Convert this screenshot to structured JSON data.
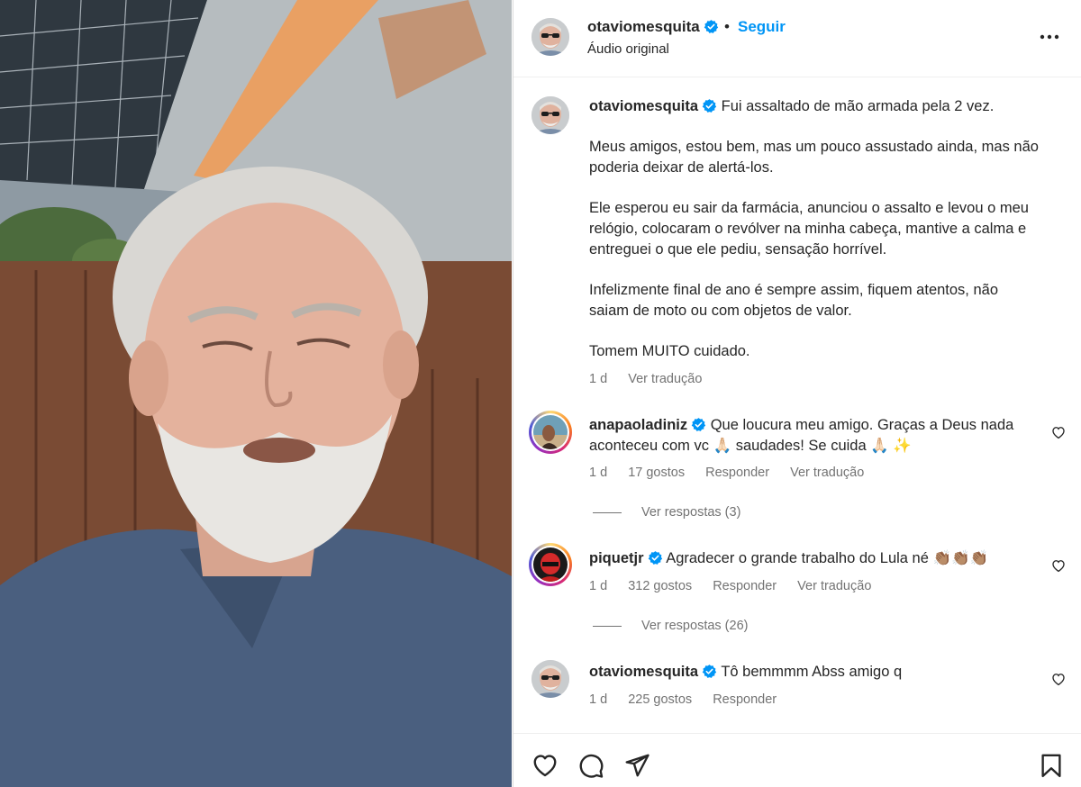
{
  "post": {
    "username": "otaviomesquita",
    "follow_label": "Seguir",
    "audio_label": "Áudio original"
  },
  "caption": {
    "username": "otaviomesquita",
    "paragraphs": [
      "Fui assaltado de mão armada pela 2 vez.",
      "Meus amigos, estou bem, mas um pouco assustado ainda, mas não poderia deixar de alertá-los.",
      "Ele esperou eu sair da farmácia, anunciou o assalto e levou o meu relógio, colocaram o revólver na minha cabeça, mantive a calma e entreguei o que ele pediu, sensação horrível.",
      "Infelizmente final de ano é sempre assim, fiquem atentos, não saiam de moto ou com objetos de valor.",
      "Tomem MUITO cuidado."
    ],
    "age": "1 d",
    "translate_label": "Ver tradução"
  },
  "comments": [
    {
      "username": "anapaoladiniz",
      "text": "Que loucura meu amigo. Graças a Deus nada aconteceu com vc 🙏🏻 saudades! Se cuida 🙏🏻 ✨",
      "age": "1 d",
      "likes": "17 gostos",
      "reply_label": "Responder",
      "translate_label": "Ver tradução",
      "view_replies": "Ver respostas (3)"
    },
    {
      "username": "piquetjr",
      "text": "Agradecer o grande trabalho do Lula né 👏🏽👏🏽👏🏽",
      "age": "1 d",
      "likes": "312 gostos",
      "reply_label": "Responder",
      "translate_label": "Ver tradução",
      "view_replies": "Ver respostas (26)"
    },
    {
      "username": "otaviomesquita",
      "text": "Tô bemmmm Abss amigo q",
      "age": "1 d",
      "likes": "225 gostos",
      "reply_label": "Responder"
    }
  ],
  "icons": {
    "verified": "verified-badge-icon",
    "more": "more-options-icon",
    "like": "heart-icon",
    "comment": "comment-icon",
    "share": "send-icon",
    "save": "bookmark-icon"
  },
  "colors": {
    "link": "#0095f6",
    "verified": "#0095f6",
    "muted": "#737373",
    "text": "#262626"
  }
}
